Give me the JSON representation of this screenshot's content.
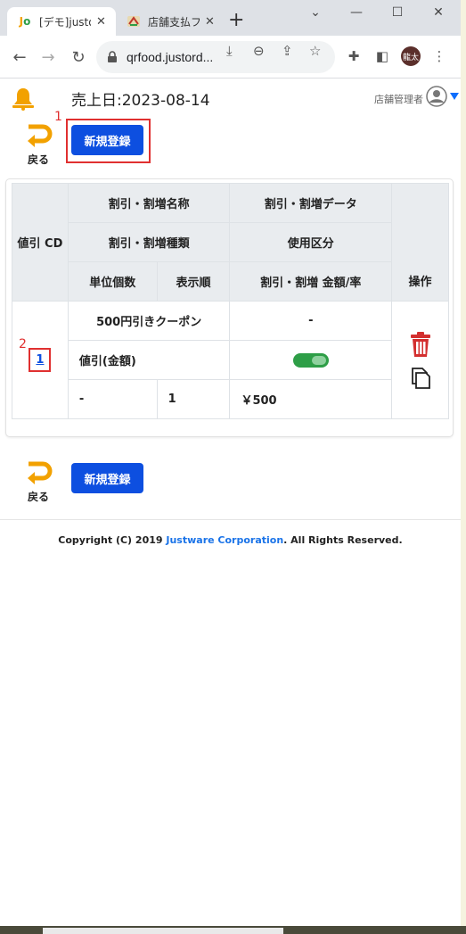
{
  "browser": {
    "tabs": [
      {
        "title": "[デモ]justo",
        "favicon": "jo-logo-icon"
      },
      {
        "title": "店舗支払フ",
        "favicon": "store-icon"
      }
    ],
    "new_tab": "+",
    "window": {
      "minimize": "⌄",
      "restore": "—",
      "maximize": "☐",
      "close": "✕"
    },
    "url": "qrfood.justord...",
    "profile_initials": "龍太"
  },
  "header": {
    "sales_date": "売上日:2023-08-14",
    "manager_label": "店舗管理者"
  },
  "actions": {
    "back_label": "戻る",
    "new_register_label": "新規登録",
    "marker_1": "1",
    "marker_2": "2"
  },
  "table": {
    "headers": {
      "discount_cd": "値引 CD",
      "name": "割引・割増名称",
      "data": "割引・割増データ",
      "type": "割引・割増種類",
      "usage": "使用区分",
      "unit_count": "単位個数",
      "display_order": "表示順",
      "amount_rate": "割引・割増 金額/率",
      "operation": "操作"
    },
    "rows": [
      {
        "cd": "1",
        "name": "500円引きクーポン",
        "data": "-",
        "type": "値引(金額)",
        "usage_enabled": true,
        "unit_count": "-",
        "display_order": "1",
        "amount": "￥500"
      }
    ]
  },
  "footer": {
    "prefix": "Copyright (C) 2019 ",
    "company": "Justware Corporation",
    "suffix": ". All Rights Reserved."
  },
  "colors": {
    "primary": "#0d4fe0",
    "bell": "#f2a100",
    "back_arrow": "#f2a100",
    "delete": "#d32f2f",
    "toggle_on": "#2e9e47",
    "marker": "#e03030"
  }
}
